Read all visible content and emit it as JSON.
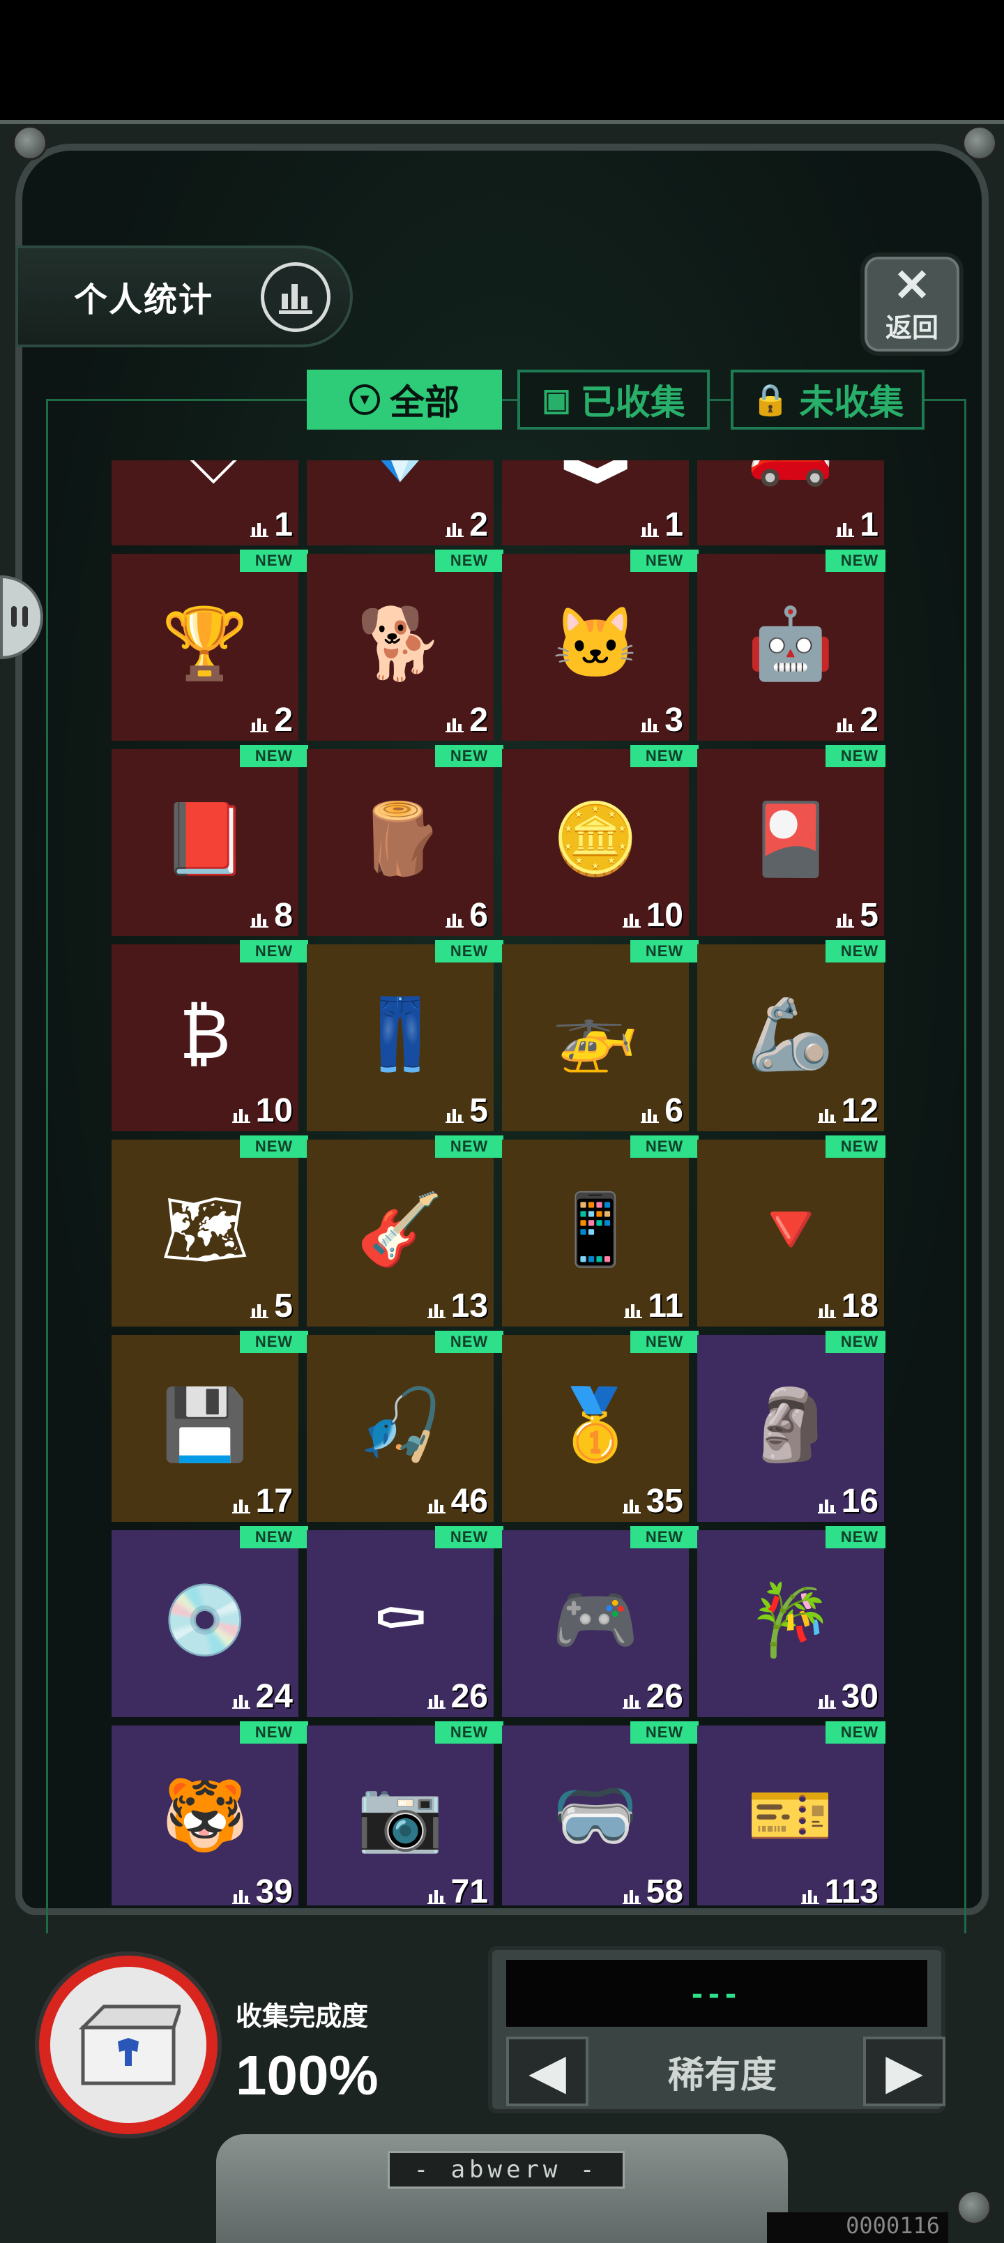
{
  "header": {
    "stats_label": "个人统计",
    "return_label": "返回"
  },
  "tabs": [
    {
      "label": "全部",
      "active": true
    },
    {
      "label": "已收集",
      "active": false
    },
    {
      "label": "未收集",
      "active": false
    }
  ],
  "new_badge": "NEW",
  "items": [
    {
      "count": "1",
      "bg": "red",
      "new": false,
      "icon": "congratulation-card-icon",
      "glyph": "🏷"
    },
    {
      "count": "2",
      "bg": "red",
      "new": false,
      "icon": "crystal-shard-icon",
      "glyph": "💎"
    },
    {
      "count": "1",
      "bg": "red",
      "new": false,
      "icon": "arcade-machine-icon",
      "glyph": "🕹"
    },
    {
      "count": "1",
      "bg": "red",
      "new": false,
      "icon": "sports-car-icon",
      "glyph": "🚗"
    },
    {
      "count": "2",
      "bg": "red",
      "new": true,
      "icon": "trophy-cup-icon",
      "glyph": "🏆"
    },
    {
      "count": "2",
      "bg": "red",
      "new": true,
      "icon": "dog-statue-icon",
      "glyph": "🐕"
    },
    {
      "count": "3",
      "bg": "red",
      "new": true,
      "icon": "cat-plush-icon",
      "glyph": "🐱"
    },
    {
      "count": "2",
      "bg": "red",
      "new": true,
      "icon": "drone-robot-icon",
      "glyph": "🤖"
    },
    {
      "count": "8",
      "bg": "red",
      "new": true,
      "icon": "red-card-icon",
      "glyph": "📕"
    },
    {
      "count": "6",
      "bg": "red",
      "new": true,
      "icon": "wood-plank-icon",
      "glyph": "🪵"
    },
    {
      "count": "10",
      "bg": "red",
      "new": true,
      "icon": "silver-coin-icon",
      "glyph": "🪙"
    },
    {
      "count": "5",
      "bg": "red",
      "new": true,
      "icon": "congratulation-card-icon",
      "glyph": "🎴"
    },
    {
      "count": "10",
      "bg": "red",
      "new": true,
      "icon": "bitcoin-icon",
      "glyph": "₿"
    },
    {
      "count": "5",
      "bg": "gold",
      "new": true,
      "icon": "overalls-icon",
      "glyph": "👖"
    },
    {
      "count": "6",
      "bg": "gold",
      "new": true,
      "icon": "quadcopter-icon",
      "glyph": "🚁"
    },
    {
      "count": "12",
      "bg": "gold",
      "new": true,
      "icon": "robot-dog-icon",
      "glyph": "🦾"
    },
    {
      "count": "5",
      "bg": "gold",
      "new": true,
      "icon": "map-icon",
      "glyph": "🗺"
    },
    {
      "count": "13",
      "bg": "gold",
      "new": true,
      "icon": "guitar-icon",
      "glyph": "🎸"
    },
    {
      "count": "11",
      "bg": "gold",
      "new": true,
      "icon": "gold-phone-icon",
      "glyph": "📱"
    },
    {
      "count": "18",
      "bg": "gold",
      "new": true,
      "icon": "spinning-top-icon",
      "glyph": "🔻"
    },
    {
      "count": "17",
      "bg": "gold",
      "new": true,
      "icon": "graphics-card-icon",
      "glyph": "💾"
    },
    {
      "count": "46",
      "bg": "gold",
      "new": true,
      "icon": "fishing-float-icon",
      "glyph": "🎣"
    },
    {
      "count": "35",
      "bg": "gold",
      "new": true,
      "icon": "gold-ingot-icon",
      "glyph": "🥇"
    },
    {
      "count": "16",
      "bg": "purple",
      "new": true,
      "icon": "terracotta-warrior-icon",
      "glyph": "🗿"
    },
    {
      "count": "24",
      "bg": "purple",
      "new": true,
      "icon": "turntable-icon",
      "glyph": "💿"
    },
    {
      "count": "26",
      "bg": "purple",
      "new": true,
      "icon": "pallbearers-icon",
      "glyph": "⚰"
    },
    {
      "count": "26",
      "bg": "purple",
      "new": true,
      "icon": "bmo-console-icon",
      "glyph": "🎮"
    },
    {
      "count": "30",
      "bg": "purple",
      "new": true,
      "icon": "flute-icon",
      "glyph": "🎋"
    },
    {
      "count": "39",
      "bg": "purple",
      "new": true,
      "icon": "tiger-scroll-icon",
      "glyph": "🐯"
    },
    {
      "count": "71",
      "bg": "purple",
      "new": true,
      "icon": "camera-icon",
      "glyph": "📷"
    },
    {
      "count": "58",
      "bg": "purple",
      "new": true,
      "icon": "vr-headset-icon",
      "glyph": "🥽"
    },
    {
      "count": "113",
      "bg": "purple",
      "new": true,
      "icon": "ticket-card-icon",
      "glyph": "🎫"
    }
  ],
  "completion": {
    "label": "收集完成度",
    "value": "100%"
  },
  "rarity": {
    "screen_text": "---",
    "label": "稀有度"
  },
  "plate_label": "- abwerw -",
  "serial": "0000116"
}
